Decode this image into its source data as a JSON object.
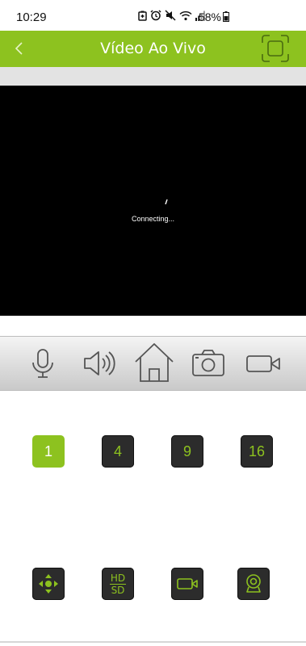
{
  "status_bar": {
    "time": "10:29",
    "battery": "58%",
    "icons": [
      "battery-saver-icon",
      "alarm-icon",
      "mute-icon",
      "wifi-icon",
      "signal-icon",
      "battery-icon"
    ]
  },
  "header": {
    "title": "Vídeo Ao Vivo",
    "back_icon": "chevron-left-icon",
    "fullscreen_icon": "fullscreen-icon",
    "color": "#8dc21f"
  },
  "video": {
    "status_text": "Connecting..."
  },
  "toolbar": {
    "items": [
      "microphone-icon",
      "speaker-icon",
      "home-icon",
      "camera-icon",
      "video-record-icon"
    ]
  },
  "grid_options": {
    "buttons": [
      "1",
      "4",
      "9",
      "16"
    ],
    "selected": "1"
  },
  "functions": {
    "hd_label": "HD",
    "sd_label": "SD",
    "items": [
      "ptz-control-icon",
      "hd-sd-toggle",
      "record-icon",
      "camera-view-icon"
    ]
  }
}
